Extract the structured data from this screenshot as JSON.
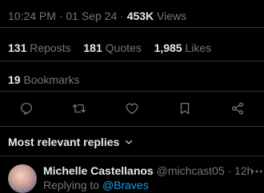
{
  "tweet_meta": {
    "time": "10:24 PM",
    "separator": "·",
    "date": "01 Sep 24",
    "views_count": "453K",
    "views_label": "Views"
  },
  "stats": {
    "reposts_count": "131",
    "reposts_label": "Reposts",
    "quotes_count": "181",
    "quotes_label": "Quotes",
    "likes_count": "1,985",
    "likes_label": "Likes",
    "bookmarks_count": "19",
    "bookmarks_label": "Bookmarks"
  },
  "actions": {
    "icons": [
      "reply-icon",
      "repost-icon",
      "like-icon",
      "bookmark-icon",
      "share-icon"
    ]
  },
  "replies_filter": {
    "label": "Most relevant replies"
  },
  "reply": {
    "name": "Michelle Castellanos",
    "handle": "@michcast05",
    "separator": "·",
    "time": "12h",
    "replying_prefix": "Replying to",
    "replying_to": "@Braves"
  },
  "colors": {
    "background": "#000000",
    "text": "#e7e9ea",
    "muted": "#71767b",
    "divider": "#2f3336",
    "link": "#1d9bf0"
  }
}
